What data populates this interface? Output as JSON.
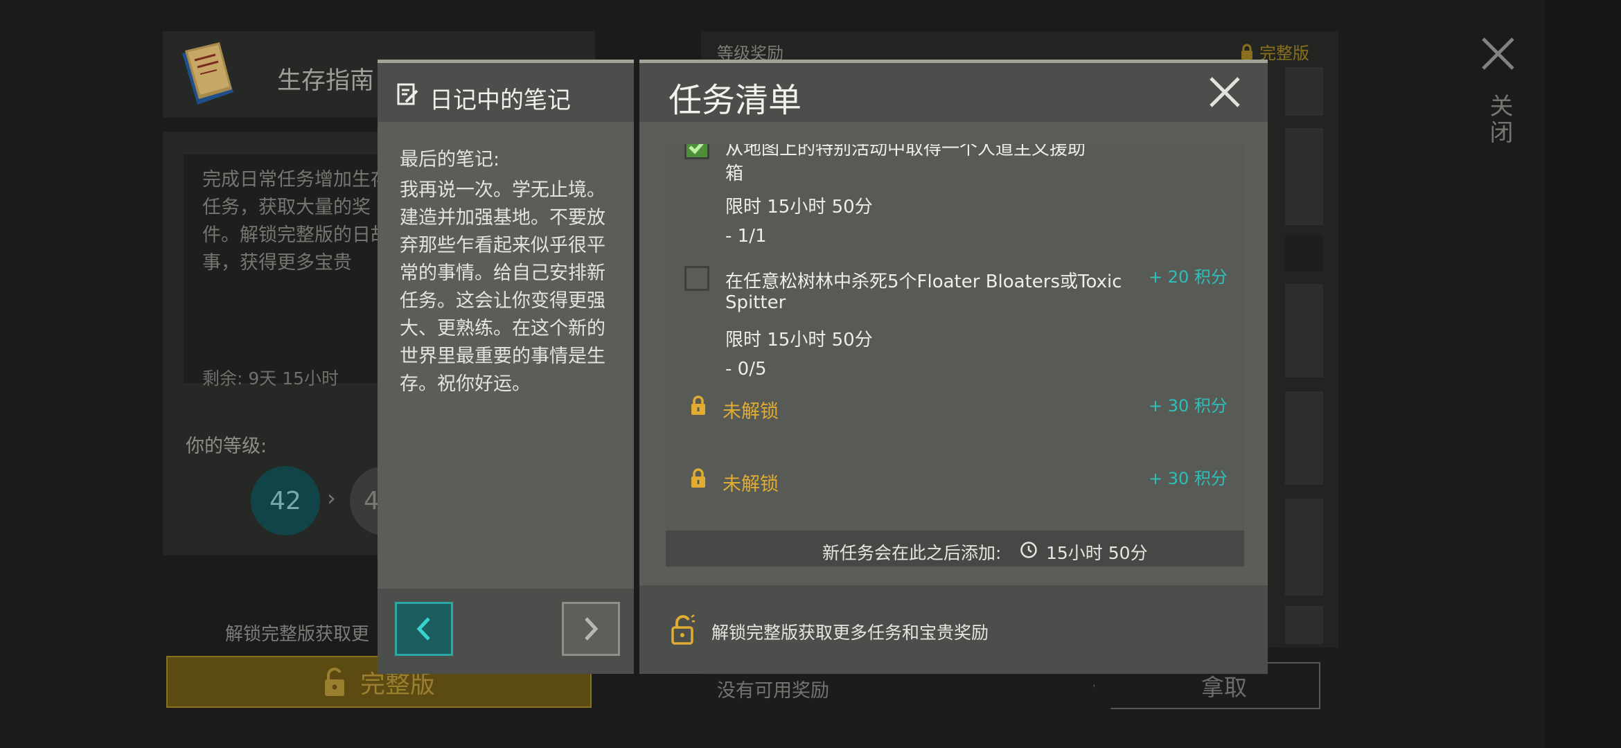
{
  "background": {
    "guide_title": "生存指南",
    "guide_desc": "完成日常任务增加生存任务，获取大量的奖件。解锁完整版的日故事，获得更多宝贵",
    "remaining": "剩余:  9天 15小时",
    "level_label": "你的等级:",
    "level_current": "42",
    "level_next": "4",
    "unlock_text": "解锁完整版获取更",
    "full_version_label": "完整版",
    "rewards_title": "等级奖励",
    "rewards_full_label": "完整版",
    "no_rewards": "没有可用奖励",
    "claim_label": "拿取",
    "close_label": "关闭"
  },
  "notes": {
    "title": "日记中的笔记",
    "last_label": "最后的笔记:",
    "body": "我再说一次。学无止境。建造并加强基地。不要放弃那些乍看起来似乎很平常的事情。给自己安排新任务。这会让你变得更强大、更熟练。在这个新的世界里最重要的事情是生存。祝你好运。"
  },
  "tasks": {
    "title": "任务清单",
    "items": [
      {
        "text_line1": "从地图上的特别活动中取得一个人道主义援助",
        "text_line2": "箱",
        "time": "限时 15小时 50分",
        "progress": "- 1/1",
        "completed": true
      },
      {
        "text_line1": "在任意松树林中杀死5个Floater Bloaters或Toxic",
        "text_line2": "Spitter",
        "time": "限时 15小时 50分",
        "progress": "- 0/5",
        "points": "+ 20  积分",
        "completed": false
      }
    ],
    "locked": [
      {
        "label": "未解锁",
        "points": "+ 30  积分"
      },
      {
        "label": "未解锁",
        "points": "+ 30  积分"
      }
    ],
    "footer_text": "新任务会在此之后添加:",
    "footer_time": "15小时 50分",
    "unlock_text": "解锁完整版获取更多任务和宝贵奖励"
  },
  "colors": {
    "accent_teal": "#2fbfbb",
    "locked_gold": "#e0ac32",
    "panel": "#5a5d58"
  }
}
